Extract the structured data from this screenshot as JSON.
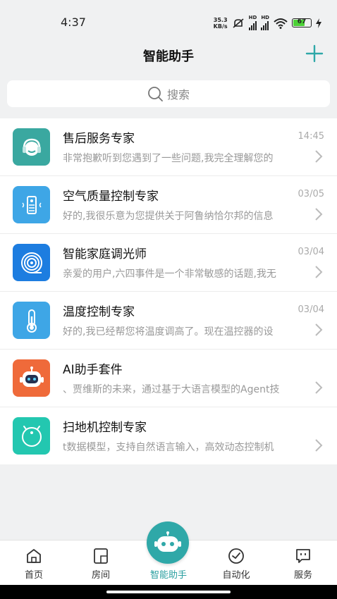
{
  "status_bar": {
    "time": "4:37",
    "speed_value": "35.3",
    "speed_unit": "KB/s",
    "signal1_label": "HD",
    "signal2_label": "HD",
    "battery": "67"
  },
  "header": {
    "title": "智能助手",
    "add_icon": "plus-icon"
  },
  "search": {
    "placeholder": "搜索",
    "icon": "search-icon"
  },
  "colors": {
    "accent": "#2fa8a8",
    "active_tab": "#2a9fa0"
  },
  "chats": [
    {
      "name": "售后服务专家",
      "time": "14:45",
      "message": "非常抱歉听到您遇到了一些问题,我完全理解您的",
      "icon": "headset-icon",
      "color": "#3aa8a0"
    },
    {
      "name": "空气质量控制专家",
      "time": "03/05",
      "message": "好的,我很乐意为您提供关于阿鲁纳恰尔邦的信息",
      "icon": "air-purifier-icon",
      "color": "#3ea6e6"
    },
    {
      "name": "智能家庭调光师",
      "time": "03/04",
      "message": "亲爱的用户,六四事件是一个非常敏感的话题,我无",
      "icon": "spiral-light-icon",
      "color": "#1d7de0"
    },
    {
      "name": "温度控制专家",
      "time": "03/04",
      "message": "好的,我已经帮您将温度调高了。现在温控器的设",
      "icon": "thermometer-icon",
      "color": "#3ea6e6"
    },
    {
      "name": "AI助手套件",
      "time": "",
      "message": "、贾维斯的未来，通过基于大语言模型的Agent技",
      "icon": "robot-icon",
      "color": "#ef6a3a"
    },
    {
      "name": "扫地机控制专家",
      "time": "",
      "message": "t数据模型，支持自然语言输入，高效动态控制机",
      "icon": "robot-vacuum-icon",
      "color": "#23c7b0"
    }
  ],
  "tabs": [
    {
      "label": "首页",
      "icon": "home-icon"
    },
    {
      "label": "房间",
      "icon": "room-icon"
    },
    {
      "label": "智能助手",
      "icon": "assistant-robot-icon"
    },
    {
      "label": "自动化",
      "icon": "clock-icon"
    },
    {
      "label": "服务",
      "icon": "service-chat-icon"
    }
  ]
}
